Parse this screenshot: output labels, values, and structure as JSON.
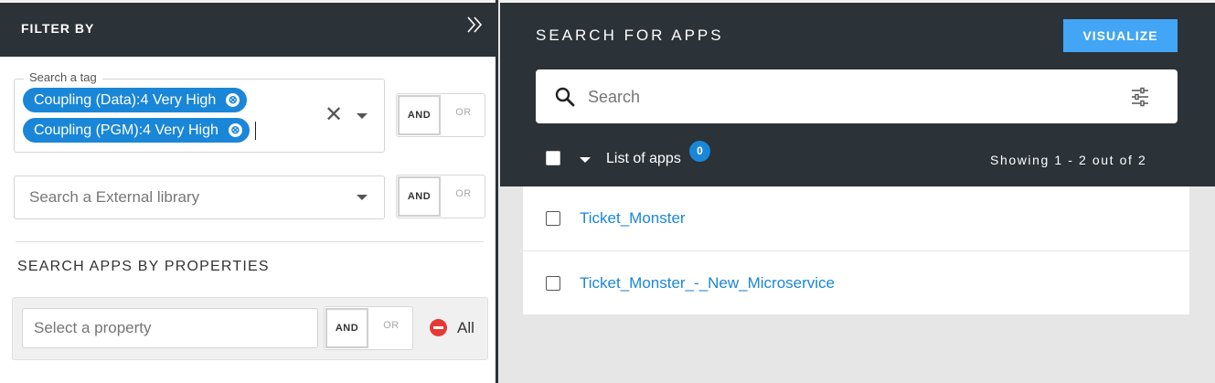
{
  "filter_panel": {
    "title": "FILTER BY",
    "collapse_icon": "double-chevron-right-icon",
    "tag_search": {
      "label": "Search a tag",
      "chips": [
        "Coupling (Data):4 Very High",
        "Coupling (PGM):4 Very High"
      ],
      "chip_remove_glyph": "⊗",
      "clear_glyph": "✕",
      "logic": {
        "and": "AND",
        "or": "OR",
        "selected": "AND"
      }
    },
    "external_library": {
      "placeholder": "Search a External library",
      "logic": {
        "and": "AND",
        "or": "OR",
        "selected": "AND"
      }
    },
    "properties": {
      "section_title": "SEARCH APPS BY PROPERTIES",
      "placeholder": "Select a property",
      "logic": {
        "and": "AND",
        "or": "OR",
        "selected": "AND"
      },
      "all_label": "All",
      "remove_icon": "minus-circle-icon",
      "remove_color": "#e53935"
    }
  },
  "apps_panel": {
    "title": "SEARCH FOR APPS",
    "visualize_label": "VISUALIZE",
    "search_placeholder": "Search",
    "search_icon": "search-icon",
    "filter_icon": "sliders-icon",
    "list_label": "List of apps",
    "selected_count": "0",
    "showing_text": "Showing 1 - 2 out of 2",
    "apps": [
      "Ticket_Monster",
      "Ticket_Monster_-_New_Microservice"
    ]
  },
  "colors": {
    "header_bg": "#2b3238",
    "accent": "#1a86d8",
    "button_blue": "#42a5f5",
    "background": "#e6e6e6"
  }
}
